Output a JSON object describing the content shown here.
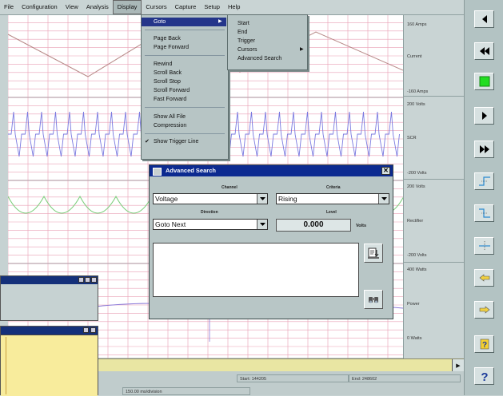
{
  "menubar": {
    "items": [
      "File",
      "Configuration",
      "View",
      "Analysis",
      "Display",
      "Cursors",
      "Capture",
      "Setup",
      "Help"
    ],
    "active": "Display"
  },
  "display_menu": {
    "items": [
      {
        "label": "Goto",
        "selected": true,
        "submenu": true
      },
      {
        "label": "Page Back"
      },
      {
        "label": "Page Forward"
      },
      {
        "label": "Rewind"
      },
      {
        "label": "Scroll Back"
      },
      {
        "label": "Scroll Stop"
      },
      {
        "label": "Scroll Forward"
      },
      {
        "label": "Fast Forward"
      },
      {
        "label": "Show All File"
      },
      {
        "label": "Compression"
      },
      {
        "label": "Show Trigger Line",
        "checked": true
      }
    ]
  },
  "goto_submenu": {
    "items": [
      "Start",
      "End",
      "Trigger",
      "Cursors",
      "Advanced Search"
    ]
  },
  "scales": {
    "ch1": {
      "top": "160 Amps",
      "name": "Current",
      "bottom": "-160 Amps"
    },
    "ch2": {
      "top": "200 Volts",
      "name": "SCR",
      "bottom": "-200 Volts"
    },
    "ch3": {
      "top": "200 Volts",
      "name": "Rectifier",
      "bottom": "-200 Volts"
    },
    "ch4": {
      "top": "400 Watts",
      "name": "Power",
      "bottom": "0 Watts"
    }
  },
  "dialog": {
    "title": "Advanced Search",
    "channel_label": "Channel",
    "channel_value": "Voltage",
    "criteria_label": "Criteria",
    "criteria_value": "Rising",
    "direction_label": "Direction",
    "direction_value": "Goto Next",
    "level_label": "Level",
    "level_value": "0.000",
    "level_units": "Volts"
  },
  "status": {
    "start": "Start: 144205",
    "end": "End: 248602",
    "resolution": "150.00 ms/division"
  },
  "colors": {
    "grid": "#e99fb5",
    "trace_current": "#b88a88",
    "trace_scr": "#7a7ae0",
    "trace_rectifier": "#77cc77",
    "trace_power": "#8a78d8",
    "title_bar": "#0c2a90",
    "menu_selected": "#24358a",
    "record_green": "#22dd22"
  },
  "toolbar": {
    "buttons": [
      "rewind-start-icon",
      "rewind-icon",
      "stop-record-icon",
      "play-forward-icon",
      "fast-forward-icon",
      "trigger-rising-icon",
      "trigger-falling-icon",
      "trigger-level-icon",
      "cursor-left-icon",
      "cursor-right-icon",
      "help-search-icon",
      "help-icon"
    ]
  }
}
